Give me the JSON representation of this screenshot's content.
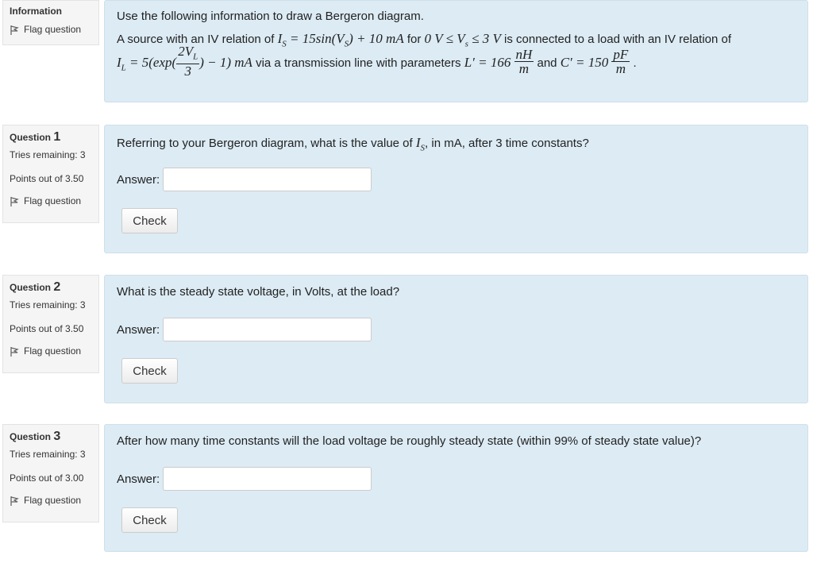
{
  "info_block": {
    "label": "Information",
    "flag_label": "Flag question",
    "line1": "Use the following information to draw a Bergeron diagram.",
    "line2_a": "A source with an IV relation of ",
    "is_eq": "I",
    "is_sub": "S",
    "is_rhs": " = 15sin(V",
    "vs_sub": "S",
    "is_rhs2": ") + 10 mA",
    "for_text": " for ",
    "range": "0 V ≤ V",
    "range_sub": "s",
    "range2": " ≤ 3 V",
    "line2_b": " is connected to a load with an IV relation of",
    "il": "I",
    "il_sub": "L",
    "il_eq": " = 5(exp(",
    "frac_num": "2V",
    "frac_num_sub": "L",
    "frac_den": "3",
    "il_tail": ") − 1) mA",
    "via_text": " via a transmission line with parameters ",
    "lprime": "L′ = 166",
    "l_num": "nH",
    "l_den": "m",
    "and_text": " and ",
    "cprime": "C′ = 150",
    "c_num": "pF",
    "c_den": "m",
    "period": " ."
  },
  "questions": [
    {
      "prefix": "Question",
      "number": "1",
      "tries": "Tries remaining: 3",
      "points": "Points out of 3.50",
      "flag_label": "Flag question",
      "text_a": "Referring to your Bergeron diagram, what is the value of ",
      "math": "I",
      "math_sub": "S",
      "text_b": ", in mA, after 3 time constants?",
      "answer_label": "Answer:",
      "check_label": "Check"
    },
    {
      "prefix": "Question",
      "number": "2",
      "tries": "Tries remaining: 3",
      "points": "Points out of 3.50",
      "flag_label": "Flag question",
      "text_a": "What is the steady state voltage, in Volts, at the load?",
      "answer_label": "Answer:",
      "check_label": "Check"
    },
    {
      "prefix": "Question",
      "number": "3",
      "tries": "Tries remaining: 3",
      "points": "Points out of 3.00",
      "flag_label": "Flag question",
      "text_a": "After how many time constants will the load voltage be roughly steady state (within 99% of steady state value)?",
      "answer_label": "Answer:",
      "check_label": "Check"
    }
  ]
}
